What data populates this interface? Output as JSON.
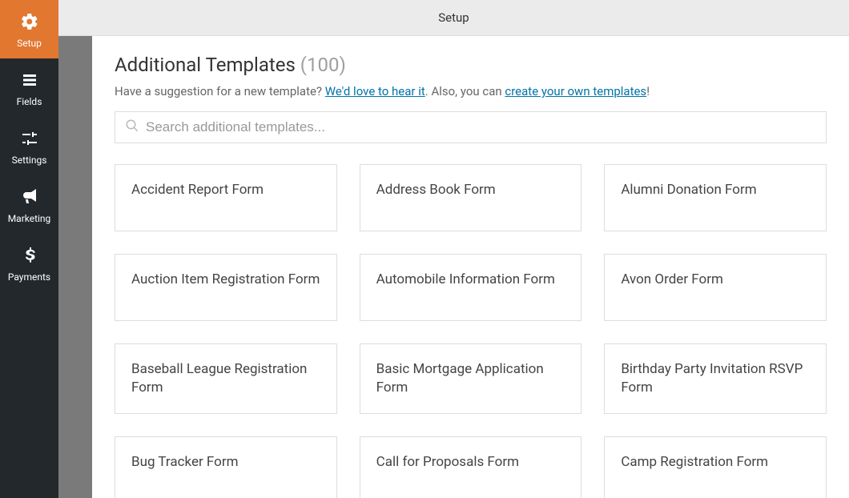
{
  "sidebar": {
    "items": [
      {
        "label": "Setup"
      },
      {
        "label": "Fields"
      },
      {
        "label": "Settings"
      },
      {
        "label": "Marketing"
      },
      {
        "label": "Payments"
      }
    ]
  },
  "header": {
    "title": "Setup"
  },
  "page": {
    "title": "Additional Templates",
    "count": "(100)",
    "sub_prefix": "Have a suggestion for a new template? ",
    "sub_link1": "We'd love to hear it",
    "sub_mid": ". Also, you can ",
    "sub_link2": "create your own templates",
    "sub_suffix": "!"
  },
  "search": {
    "placeholder": "Search additional templates..."
  },
  "templates": [
    {
      "name": "Accident Report Form"
    },
    {
      "name": "Address Book Form"
    },
    {
      "name": "Alumni Donation Form"
    },
    {
      "name": "Auction Item Registration Form"
    },
    {
      "name": "Automobile Information Form"
    },
    {
      "name": "Avon Order Form"
    },
    {
      "name": "Baseball League Registration Form"
    },
    {
      "name": "Basic Mortgage Application Form"
    },
    {
      "name": "Birthday Party Invitation RSVP Form"
    },
    {
      "name": "Bug Tracker Form"
    },
    {
      "name": "Call for Proposals Form"
    },
    {
      "name": "Camp Registration Form"
    }
  ]
}
